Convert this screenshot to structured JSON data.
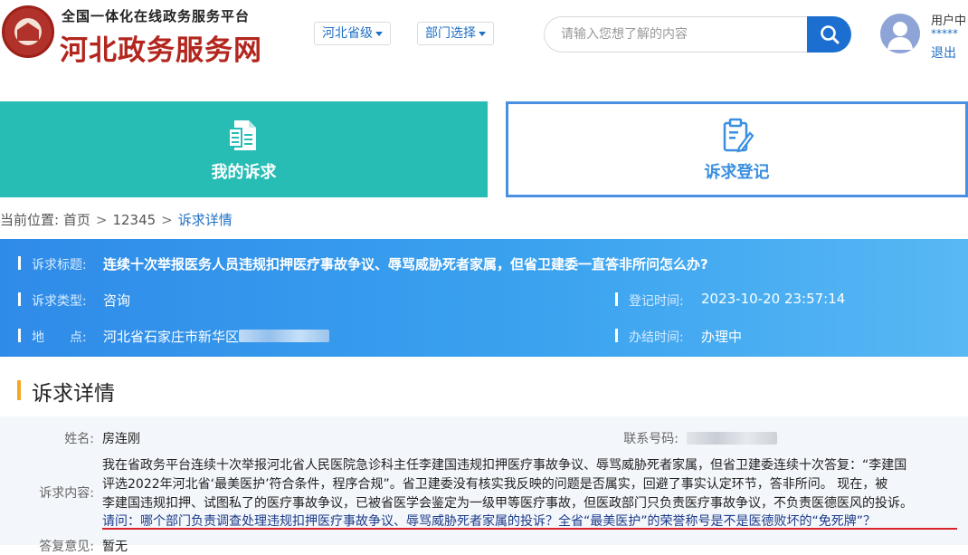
{
  "header": {
    "platform_subtitle": "全国一体化在线政务服务平台",
    "site_title": "河北政务服务网",
    "region_select": "河北省级",
    "dept_select": "部门选择",
    "search_placeholder": "请输入您想了解的内容",
    "user_label": "用户中",
    "user_masked": "*****",
    "logout": "退出",
    "accent_color": "#1c6fd0",
    "brand_color": "#b3261e"
  },
  "tiles": {
    "mine": "我的诉求",
    "register": "诉求登记"
  },
  "breadcrumb": {
    "prefix": "当前位置:",
    "home": "首页",
    "section": "12345",
    "current": "诉求详情"
  },
  "info": {
    "title_label": "诉求标题:",
    "title_value": "连续十次举报医务人员违规扣押医疗事故争议、辱骂威胁死者家属，但省卫建委一直答非所问怎么办?",
    "type_label": "诉求类型:",
    "type_value": "咨询",
    "reg_time_label": "登记时间:",
    "reg_time_value": "2023-10-20 23:57:14",
    "location_label": "地　　点:",
    "location_value": "河北省石家庄市新华区",
    "finish_label": "办结时间:",
    "finish_value": "办理中"
  },
  "detail": {
    "section_title": "诉求详情",
    "name_label": "姓名:",
    "name_value": "房连刚",
    "phone_label": "联系号码:",
    "content_label": "诉求内容:",
    "content_lines": [
      "我在省政务平台连续十次举报河北省人民医院急诊科主任李建国违规扣押医疗事故争议、辱骂威胁死者家属，但省卫建委连续十次答复：“李建国",
      "评选2022年河北省‘最美医护’符合条件，程序合规”。省卫建委没有核实我反映的问题是否属实，回避了事实认定环节，答非所问。 现在，被",
      "李建国违规扣押、试图私了的医疗事故争议，已被省医学会鉴定为一级甲等医疗事故，但医政部门只负责医疗事故争议，不负责医德医风的投诉。",
      "请问：哪个部门负责调查处理违规扣押医疗事故争议、辱骂威胁死者家属的投诉？全省“最美医护”的荣誉称号是不是医德败坏的“免死牌”？"
    ],
    "reply_label": "答复意见:",
    "reply_value": "暂无"
  }
}
